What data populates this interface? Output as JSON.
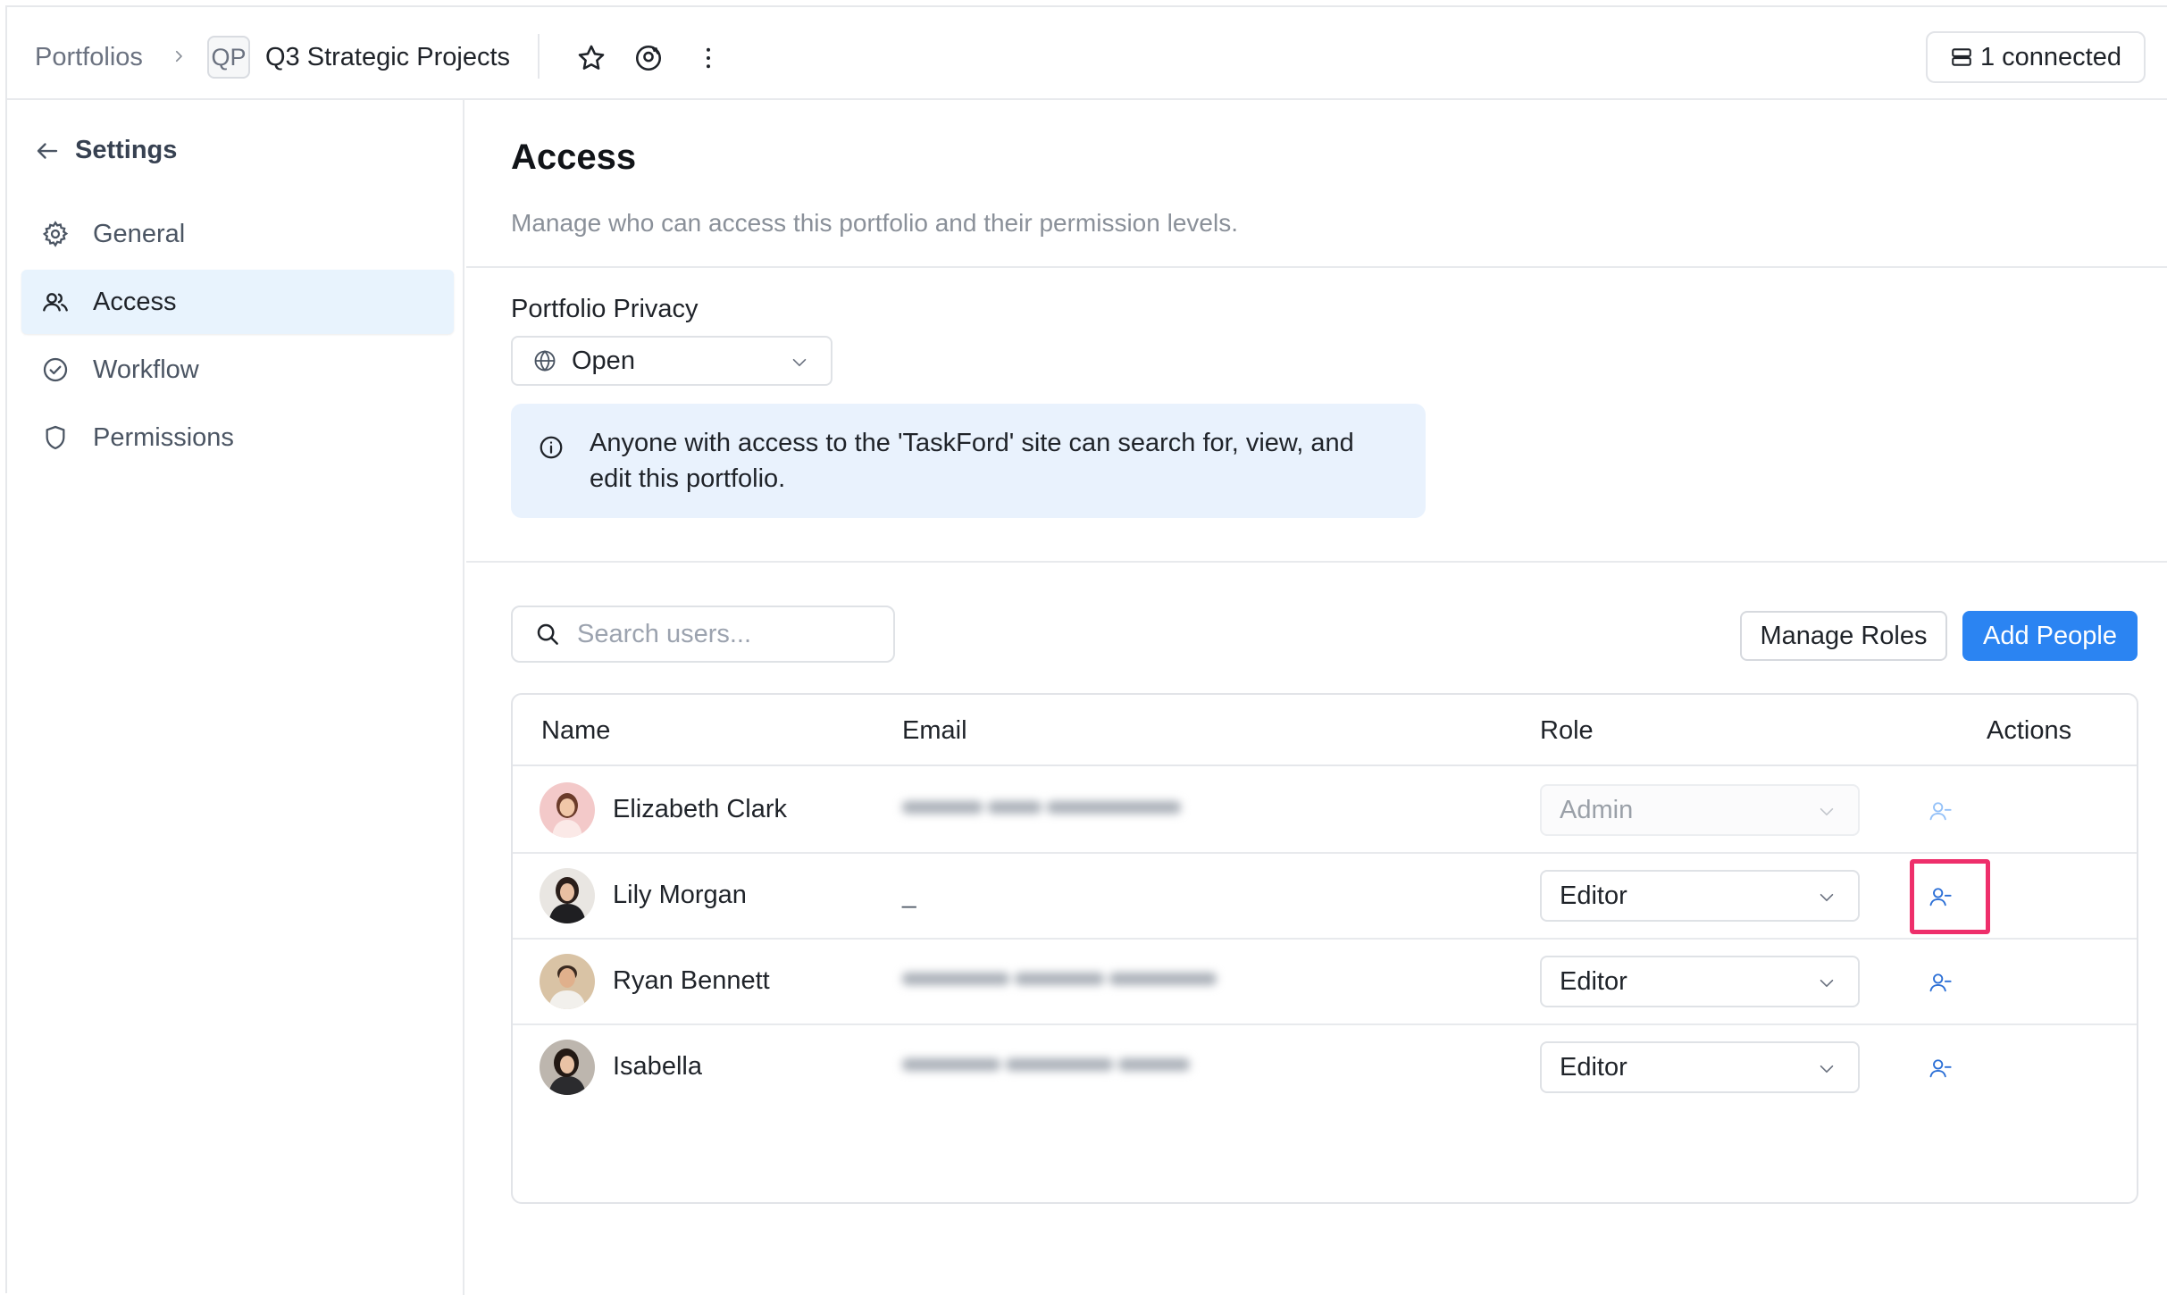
{
  "topbar": {
    "breadcrumb_root": "Portfolios",
    "project_badge": "QP",
    "project_title": "Q3 Strategic Projects",
    "connected_label": "1 connected"
  },
  "sidebar": {
    "back_label": "Settings",
    "items": [
      {
        "label": "General",
        "icon": "gear-icon"
      },
      {
        "label": "Access",
        "icon": "users-icon",
        "active": true
      },
      {
        "label": "Workflow",
        "icon": "check-circle-icon"
      },
      {
        "label": "Permissions",
        "icon": "shield-icon"
      }
    ]
  },
  "main": {
    "title": "Access",
    "description": "Manage who can access this portfolio and their permission levels.",
    "privacy": {
      "label": "Portfolio Privacy",
      "value": "Open",
      "info": "Anyone with access to the 'TaskFord' site can search for, view, and edit this portfolio."
    },
    "search": {
      "placeholder": "Search users..."
    },
    "manage_roles_label": "Manage Roles",
    "add_people_label": "Add People",
    "table": {
      "headers": {
        "name": "Name",
        "email": "Email",
        "role": "Role",
        "actions": "Actions"
      },
      "rows": [
        {
          "name": "Elizabeth Clark",
          "email": "",
          "role": "Admin",
          "role_disabled": true
        },
        {
          "name": "Lily Morgan",
          "email": "_",
          "role": "Editor"
        },
        {
          "name": "Ryan Bennett",
          "email": "",
          "role": "Editor"
        },
        {
          "name": "Isabella",
          "email": "",
          "role": "Editor"
        }
      ]
    }
  },
  "colors": {
    "accent": "#2b84f2",
    "active_nav_bg": "#e8f3fd",
    "info_bg": "#e9f2fd",
    "highlight": "#ee2f6b"
  }
}
